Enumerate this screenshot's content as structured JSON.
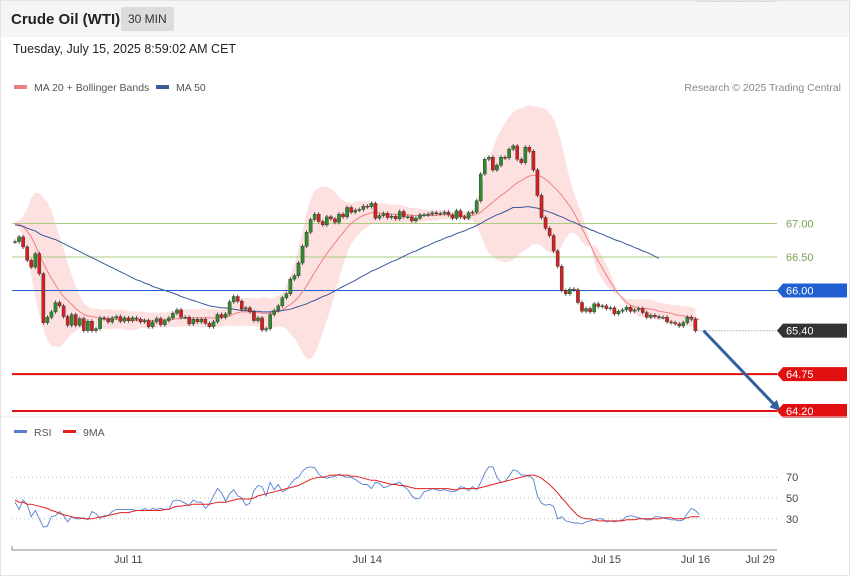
{
  "header": {
    "title": "Crude Oil (WTI)",
    "timeframe": "30 MIN",
    "timestamp": "Tuesday, July 15, 2025 8:59:02 AM CET"
  },
  "copyright": "Research © 2025 Trading Central",
  "colors": {
    "bb_fill": "#fde0e0",
    "ma20": "#f08080",
    "ma50": "#3a5a9a",
    "candle_up": "#2e8b2e",
    "candle_down": "#d42020",
    "resistance": "#a8cc80",
    "pivot": "#2060d0",
    "support": "#e01010",
    "price": "#333333",
    "arrow": "#3060a0",
    "rsi": "#5580d0",
    "rsi_ma": "#e02020"
  },
  "chart_data": [
    {
      "type": "candlestick",
      "legend": [
        {
          "label": "MA 20 + Bollinger Bands",
          "color": "#f08080"
        },
        {
          "label": "MA 50",
          "color": "#3a5a9a"
        }
      ],
      "ylim": [
        64.02,
        68.98
      ],
      "x_ticks": [
        {
          "label": "Jul 11",
          "idx": 28
        },
        {
          "label": "Jul 14",
          "idx": 87
        },
        {
          "label": "Jul 15",
          "idx": 146
        },
        {
          "label": "Jul 16",
          "idx": 168
        },
        {
          "label": "Jul 29",
          "idx": 184
        }
      ],
      "levels": [
        {
          "value": 67.0,
          "label": "67.00",
          "kind": "resistance"
        },
        {
          "value": 66.5,
          "label": "66.50",
          "kind": "resistance"
        },
        {
          "value": 66.0,
          "label": "66.00",
          "kind": "pivot"
        },
        {
          "value": 65.4,
          "label": "65.40",
          "kind": "price"
        },
        {
          "value": 64.75,
          "label": "64.75",
          "kind": "support"
        },
        {
          "value": 64.2,
          "label": "64.20",
          "kind": "support"
        }
      ],
      "forecast": {
        "from_idx": 170,
        "from_value": 65.4,
        "to_idx": 189,
        "to_value": 64.2
      },
      "close": [
        66.73,
        66.8,
        66.65,
        66.45,
        66.35,
        66.55,
        66.25,
        65.52,
        65.6,
        65.68,
        65.82,
        65.77,
        65.61,
        65.48,
        65.64,
        65.48,
        65.58,
        65.4,
        65.54,
        65.4,
        65.43,
        65.59,
        65.58,
        65.53,
        65.59,
        65.61,
        65.54,
        65.59,
        65.55,
        65.59,
        65.57,
        65.53,
        65.55,
        65.46,
        65.53,
        65.58,
        65.49,
        65.55,
        65.59,
        65.66,
        65.71,
        65.6,
        65.6,
        65.5,
        65.57,
        65.53,
        65.57,
        65.51,
        65.46,
        65.53,
        65.64,
        65.6,
        65.65,
        65.83,
        65.91,
        65.84,
        65.72,
        65.74,
        65.68,
        65.55,
        65.59,
        65.41,
        65.43,
        65.64,
        65.7,
        65.77,
        65.89,
        65.95,
        66.17,
        66.22,
        66.41,
        66.66,
        66.87,
        67.06,
        67.14,
        67.03,
        66.98,
        67.1,
        67.07,
        67.02,
        67.14,
        67.1,
        67.24,
        67.17,
        67.2,
        67.21,
        67.26,
        67.25,
        67.3,
        67.08,
        67.12,
        67.15,
        67.09,
        67.11,
        67.07,
        67.18,
        67.1,
        67.1,
        67.04,
        67.08,
        67.13,
        67.13,
        67.14,
        67.16,
        67.15,
        67.15,
        67.17,
        67.13,
        67.08,
        67.19,
        67.1,
        67.08,
        67.16,
        67.17,
        67.34,
        67.74,
        67.96,
        67.99,
        67.8,
        67.87,
        67.99,
        67.98,
        68.11,
        68.16,
        67.96,
        67.91,
        68.14,
        68.08,
        67.8,
        67.42,
        67.09,
        66.93,
        66.82,
        66.59,
        66.36,
        66.0,
        65.95,
        66.02,
        66.01,
        65.82,
        65.69,
        65.73,
        65.68,
        65.8,
        65.76,
        65.77,
        65.73,
        65.74,
        65.65,
        65.69,
        65.71,
        65.75,
        65.69,
        65.71,
        65.73,
        65.67,
        65.6,
        65.63,
        65.61,
        65.6,
        65.6,
        65.53,
        65.52,
        65.5,
        65.47,
        65.52,
        65.6,
        65.57,
        65.4
      ],
      "ma20": [
        67.0,
        66.99,
        66.95,
        66.89,
        66.8,
        66.68,
        66.54,
        66.41,
        66.29,
        66.18,
        66.08,
        65.99,
        65.91,
        65.85,
        65.79,
        65.73,
        65.68,
        65.64,
        65.62,
        65.61,
        65.6,
        65.58,
        65.57,
        65.57,
        65.57,
        65.57,
        65.57,
        65.56,
        65.55,
        65.55,
        65.55,
        65.56,
        65.56,
        65.55,
        65.55,
        65.56,
        65.56,
        65.56,
        65.57,
        65.57,
        65.58,
        65.58,
        65.59,
        65.59,
        65.59,
        65.59,
        65.59,
        65.59,
        65.59,
        65.59,
        65.59,
        65.59,
        65.6,
        65.62,
        65.65,
        65.67,
        65.68,
        65.68,
        65.68,
        65.68,
        65.67,
        65.66,
        65.66,
        65.66,
        65.67,
        65.69,
        65.71,
        65.75,
        65.79,
        65.84,
        65.9,
        65.98,
        66.07,
        66.17,
        66.27,
        66.37,
        66.46,
        66.55,
        66.63,
        66.71,
        66.79,
        66.86,
        66.94,
        67.0,
        67.05,
        67.09,
        67.12,
        67.14,
        67.16,
        67.16,
        67.16,
        67.15,
        67.15,
        67.14,
        67.14,
        67.14,
        67.13,
        67.13,
        67.12,
        67.12,
        67.12,
        67.12,
        67.12,
        67.12,
        67.12,
        67.13,
        67.13,
        67.13,
        67.12,
        67.12,
        67.12,
        67.11,
        67.12,
        67.12,
        67.14,
        67.17,
        67.22,
        67.27,
        67.32,
        67.37,
        67.42,
        67.46,
        67.51,
        67.56,
        67.61,
        67.64,
        67.68,
        67.71,
        67.72,
        67.72,
        67.7,
        67.66,
        67.61,
        67.55,
        67.49,
        67.42,
        67.34,
        67.26,
        67.16,
        67.05,
        66.93,
        66.81,
        66.69,
        66.56,
        66.44,
        66.34,
        66.23,
        66.13,
        66.03,
        65.95,
        65.88,
        65.82,
        65.78,
        65.76,
        65.74,
        65.73,
        65.73,
        65.72,
        65.71,
        65.69,
        65.68,
        65.67,
        65.66,
        65.64,
        65.63,
        65.62,
        65.61,
        65.6,
        65.59,
        65.56
      ],
      "bb_upper": [
        67.02,
        67.05,
        67.1,
        67.22,
        67.38,
        67.46,
        67.45,
        67.39,
        67.32,
        67.19,
        67.0,
        66.82,
        66.62,
        66.41,
        66.23,
        66.07,
        65.92,
        65.81,
        65.76,
        65.73,
        65.73,
        65.72,
        65.71,
        65.72,
        65.72,
        65.71,
        65.71,
        65.71,
        65.69,
        65.69,
        65.69,
        65.68,
        65.68,
        65.67,
        65.67,
        65.67,
        65.67,
        65.67,
        65.68,
        65.69,
        65.7,
        65.7,
        65.72,
        65.72,
        65.72,
        65.72,
        65.73,
        65.73,
        65.72,
        65.73,
        65.72,
        65.72,
        65.73,
        65.76,
        65.83,
        65.88,
        65.88,
        65.89,
        65.89,
        65.89,
        65.88,
        65.9,
        65.9,
        65.88,
        65.89,
        65.92,
        65.96,
        66.08,
        66.23,
        66.39,
        66.62,
        66.89,
        67.16,
        67.36,
        67.49,
        67.54,
        67.55,
        67.55,
        67.52,
        67.47,
        67.39,
        67.34,
        67.32,
        67.3,
        67.32,
        67.33,
        67.33,
        67.33,
        67.33,
        67.31,
        67.31,
        67.3,
        67.29,
        67.28,
        67.28,
        67.28,
        67.26,
        67.24,
        67.23,
        67.23,
        67.22,
        67.21,
        67.2,
        67.2,
        67.2,
        67.2,
        67.2,
        67.19,
        67.17,
        67.17,
        67.18,
        67.17,
        67.19,
        67.2,
        67.32,
        67.51,
        67.76,
        67.98,
        68.13,
        68.28,
        68.4,
        68.5,
        68.59,
        68.66,
        68.71,
        68.72,
        68.75,
        68.77,
        68.75,
        68.75,
        68.73,
        68.72,
        68.65,
        68.56,
        68.41,
        68.18,
        67.9,
        67.66,
        67.46,
        67.29,
        67.14,
        66.95,
        66.72,
        66.44,
        66.26,
        66.17,
        66.07,
        66.01,
        65.96,
        65.94,
        65.91,
        65.88,
        65.87,
        65.86,
        65.87,
        65.87,
        65.87,
        65.86,
        65.84,
        65.82,
        65.81,
        65.8,
        65.79,
        65.78,
        65.78,
        65.76,
        65.76,
        65.75,
        65.73,
        65.74
      ],
      "bb_lower": [
        66.98,
        66.93,
        66.8,
        66.56,
        66.22,
        65.9,
        65.63,
        65.43,
        65.26,
        65.17,
        65.16,
        65.16,
        65.2,
        65.29,
        65.35,
        65.39,
        65.44,
        65.47,
        65.48,
        65.49,
        65.47,
        65.44,
        65.43,
        65.42,
        65.42,
        65.43,
        65.43,
        65.41,
        65.41,
        65.41,
        65.41,
        65.44,
        65.44,
        65.43,
        65.43,
        65.45,
        65.45,
        65.45,
        65.46,
        65.45,
        65.46,
        65.46,
        65.46,
        65.46,
        65.46,
        65.46,
        65.45,
        65.45,
        65.46,
        65.45,
        65.46,
        65.46,
        65.47,
        65.48,
        65.47,
        65.46,
        65.48,
        65.47,
        65.47,
        65.47,
        65.46,
        65.42,
        65.42,
        65.44,
        65.45,
        65.46,
        65.46,
        65.42,
        65.35,
        65.29,
        65.18,
        65.07,
        64.98,
        64.98,
        65.05,
        65.2,
        65.37,
        65.55,
        65.74,
        65.95,
        66.19,
        66.38,
        66.56,
        66.7,
        66.78,
        66.85,
        66.91,
        66.95,
        66.99,
        67.01,
        67.01,
        67.0,
        67.01,
        67.0,
        67.0,
        67.0,
        67.0,
        67.02,
        67.01,
        67.01,
        67.02,
        67.03,
        67.04,
        67.04,
        67.04,
        67.06,
        67.06,
        67.07,
        67.07,
        67.07,
        67.06,
        67.05,
        67.05,
        67.04,
        66.96,
        66.83,
        66.68,
        66.56,
        66.51,
        66.46,
        66.44,
        66.42,
        66.43,
        66.46,
        66.51,
        66.56,
        66.61,
        66.65,
        66.69,
        66.69,
        66.67,
        66.6,
        66.57,
        66.54,
        66.57,
        66.66,
        66.78,
        66.86,
        66.86,
        66.81,
        66.72,
        66.67,
        66.66,
        66.68,
        66.62,
        66.51,
        66.39,
        66.25,
        66.1,
        65.96,
        65.85,
        65.76,
        65.69,
        65.66,
        65.61,
        65.59,
        65.59,
        65.58,
        65.58,
        65.56,
        65.55,
        65.54,
        65.53,
        65.5,
        65.48,
        65.48,
        65.47,
        65.46,
        65.45,
        65.38
      ],
      "ma50": [
        66.98,
        66.97,
        66.96,
        66.93,
        66.91,
        66.89,
        66.85,
        66.82,
        66.8,
        66.78,
        66.76,
        66.73,
        66.7,
        66.67,
        66.64,
        66.61,
        66.58,
        66.55,
        66.52,
        66.49,
        66.46,
        66.43,
        66.4,
        66.37,
        66.34,
        66.31,
        66.28,
        66.25,
        66.22,
        66.19,
        66.16,
        66.14,
        66.11,
        66.09,
        66.06,
        66.04,
        66.02,
        66.0,
        65.98,
        65.96,
        65.94,
        65.91,
        65.89,
        65.87,
        65.85,
        65.83,
        65.81,
        65.79,
        65.77,
        65.76,
        65.75,
        65.74,
        65.74,
        65.73,
        65.72,
        65.71,
        65.7,
        65.7,
        65.69,
        65.69,
        65.69,
        65.68,
        65.68,
        65.68,
        65.69,
        65.69,
        65.7,
        65.71,
        65.72,
        65.74,
        65.76,
        65.78,
        65.8,
        65.83,
        65.85,
        65.88,
        65.91,
        65.93,
        65.96,
        65.99,
        66.03,
        66.06,
        66.09,
        66.12,
        66.15,
        66.19,
        66.22,
        66.25,
        66.29,
        66.31,
        66.34,
        66.37,
        66.4,
        66.43,
        66.45,
        66.48,
        66.51,
        66.54,
        66.57,
        66.59,
        66.62,
        66.65,
        66.67,
        66.7,
        66.73,
        66.75,
        66.78,
        66.8,
        66.82,
        66.85,
        66.87,
        66.89,
        66.92,
        66.94,
        66.97,
        67.0,
        67.04,
        67.07,
        67.1,
        67.13,
        67.15,
        67.18,
        67.21,
        67.24,
        67.24,
        67.24,
        67.25,
        67.25,
        67.24,
        67.23,
        67.21,
        67.19,
        67.17,
        67.15,
        67.12,
        67.1,
        67.07,
        67.04,
        67.02,
        66.99,
        66.96,
        66.94,
        66.91,
        66.89,
        66.86,
        66.84,
        66.81,
        66.79,
        66.76,
        66.74,
        66.72,
        66.69,
        66.67,
        66.64,
        66.62,
        66.59,
        66.57,
        66.54,
        66.51,
        66.48
      ],
      "rsi_ticks": [
        70,
        50,
        30
      ],
      "rsi": [
        46,
        39,
        48,
        44,
        32,
        38,
        30,
        22,
        23,
        32,
        33,
        37,
        33,
        27,
        32,
        30,
        30,
        31,
        29,
        37,
        35,
        30,
        33,
        33,
        37,
        39,
        39,
        39,
        39,
        39,
        38,
        38,
        40,
        38,
        40,
        39,
        40,
        39,
        39,
        47,
        48,
        47,
        45,
        43,
        48,
        46,
        46,
        40,
        44,
        52,
        59,
        55,
        47,
        54,
        58,
        52,
        50,
        43,
        45,
        57,
        62,
        61,
        52,
        65,
        58,
        63,
        56,
        58,
        63,
        68,
        70,
        76,
        79,
        80,
        79,
        73,
        70,
        69,
        70,
        71,
        73,
        71,
        70,
        70,
        68,
        65,
        63,
        63,
        59,
        65,
        64,
        60,
        61,
        63,
        64,
        65,
        61,
        58,
        52,
        49,
        50,
        56,
        57,
        59,
        58,
        57,
        58,
        57,
        56,
        57,
        61,
        60,
        57,
        61,
        58,
        65,
        74,
        80,
        80,
        70,
        65,
        66,
        71,
        77,
        76,
        72,
        72,
        71,
        68,
        52,
        45,
        43,
        44,
        42,
        30,
        32,
        28,
        27,
        26,
        26,
        25,
        27,
        28,
        29,
        30,
        30,
        27,
        28,
        27,
        28,
        29,
        32,
        33,
        32,
        31,
        30,
        29,
        29,
        32,
        32,
        31,
        30,
        29,
        29,
        28,
        29,
        35,
        40,
        38,
        34
      ],
      "rsi_ma": [
        48,
        46,
        46,
        44,
        44,
        43,
        42,
        41,
        40,
        38,
        37,
        35,
        34,
        33,
        32,
        31,
        31,
        30,
        30,
        30,
        31,
        32,
        32,
        33,
        34,
        35,
        36,
        36,
        36,
        37,
        38,
        38,
        38,
        38,
        38,
        38,
        38,
        39,
        39,
        41,
        42,
        42,
        43,
        43,
        44,
        44,
        44,
        44,
        44,
        45,
        46,
        46,
        46,
        47,
        48,
        49,
        49,
        49,
        49,
        50,
        52,
        53,
        54,
        55,
        56,
        57,
        58,
        59,
        60,
        61,
        62,
        64,
        66,
        68,
        69,
        70,
        70,
        71,
        72,
        72,
        72,
        72,
        72,
        71,
        71,
        70,
        69,
        68,
        67,
        67,
        66,
        65,
        64,
        63,
        63,
        62,
        62,
        61,
        60,
        59,
        59,
        59,
        59,
        59,
        59,
        59,
        59,
        59,
        58,
        58,
        59,
        59,
        59,
        59,
        59,
        60,
        61,
        62,
        63,
        64,
        65,
        66,
        67,
        68,
        69,
        70,
        71,
        72,
        72,
        71,
        69,
        66,
        63,
        59,
        55,
        50,
        46,
        41,
        37,
        33,
        31,
        30,
        30,
        29,
        28,
        28,
        28,
        28,
        28,
        28,
        28,
        29,
        29,
        29,
        30,
        30,
        30,
        30,
        30,
        30,
        31,
        31,
        31,
        30,
        30,
        30,
        31,
        32,
        32,
        32
      ],
      "rsi_legend": [
        {
          "label": "RSI",
          "color": "#5580d0"
        },
        {
          "label": "9MA",
          "color": "#e02020"
        }
      ]
    }
  ]
}
